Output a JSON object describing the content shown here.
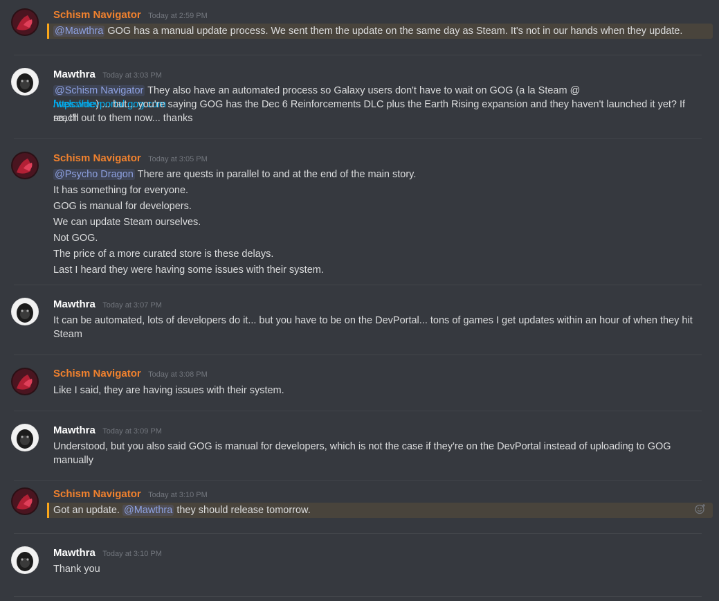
{
  "colors": {
    "background": "#36393f",
    "username_orange": "#f0812e",
    "username_white": "#ffffff",
    "mention_text": "#8ea1e1",
    "link": "#00b0f4",
    "highlight_bg": "#49443c",
    "highlight_bar": "#faa61a"
  },
  "messages": [
    {
      "author": "Schism Navigator",
      "time": "Today at 2:59 PM",
      "avatar": "schism-avatar",
      "mention": "@Mawthra",
      "text": " GOG has a manual update process. We sent them the update on the same day as Steam. It's not in our hands when they update."
    },
    {
      "author": "Mawthra",
      "time": "Today at 3:03 PM",
      "avatar": "mawthra-avatar",
      "mention": "@Schism Navigator",
      "text_a": " They also have an automated process so Galaxy users don't have to wait on GOG (a la Steam @ ",
      "link_a": "https://devportal.gog.com",
      "link_b": "/welcome",
      "text_b": ") ... but... you're saying GOG has the Dec 6 Reinforcements DLC plus the Earth Rising expansion and they haven't launched it yet? If so, I'll",
      "text_c": "reach out to them now... thanks"
    },
    {
      "author": "Schism Navigator",
      "time": "Today at 3:05 PM",
      "avatar": "schism-avatar",
      "mention": "@Psycho Dragon",
      "text": " There are quests in parallel to and at the end of the main story.",
      "lines": [
        "It has something for everyone.",
        "GOG is manual for developers.",
        "We can update Steam ourselves.",
        "Not GOG.",
        "The price of a more curated store is these delays.",
        "Last I heard they were having some issues with their system."
      ]
    },
    {
      "author": "Mawthra",
      "time": "Today at 3:07 PM",
      "avatar": "mawthra-avatar",
      "text_a": "It can be automated, lots of developers do it... but you have to be on the DevPortal... tons of games I get updates within an hour of when they hit",
      "text_b": "Steam"
    },
    {
      "author": "Schism Navigator",
      "time": "Today at 3:08 PM",
      "avatar": "schism-avatar",
      "text": "Like I said, they are having issues with their system."
    },
    {
      "author": "Mawthra",
      "time": "Today at 3:09 PM",
      "avatar": "mawthra-avatar",
      "text_a": "Understood, but you also said GOG is manual for developers, which is not the case if they're on the DevPortal instead of uploading to GOG",
      "text_b": "manually"
    },
    {
      "author": "Schism Navigator",
      "time": "Today at 3:10 PM",
      "avatar": "schism-avatar",
      "text_a": "Got an update. ",
      "mention": "@Mawthra",
      "text_b": " they should release tomorrow.",
      "reaction_icon": "add-reaction-icon"
    },
    {
      "author": "Mawthra",
      "time": "Today at 3:10 PM",
      "avatar": "mawthra-avatar",
      "text": "Thank you"
    }
  ]
}
